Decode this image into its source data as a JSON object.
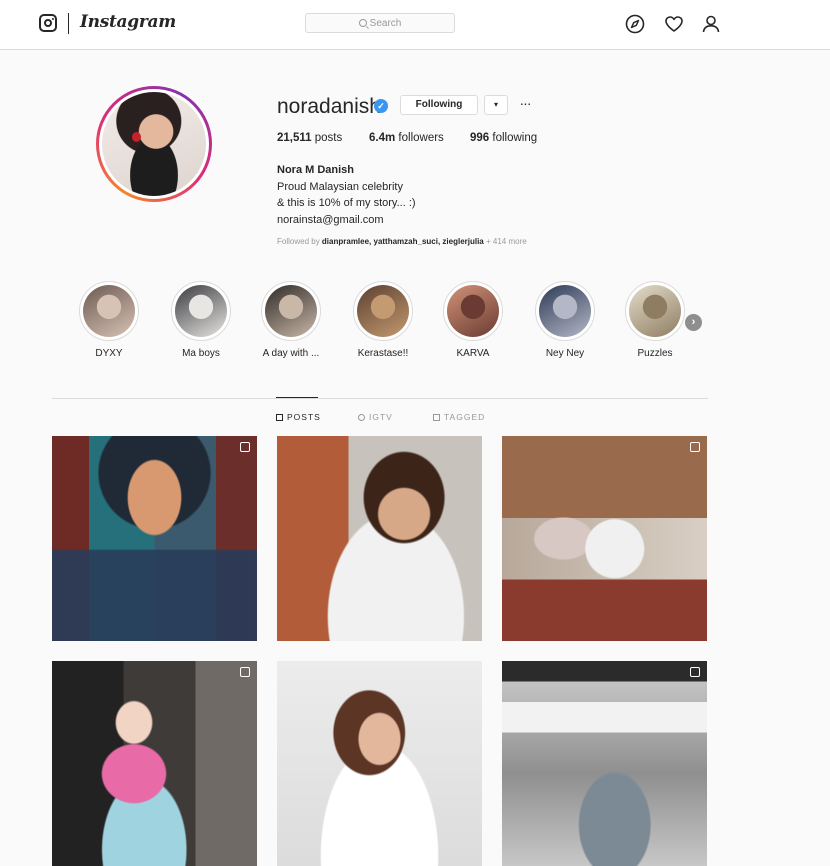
{
  "nav": {
    "logo_text": "Instagram",
    "search_placeholder": "Search",
    "icons": [
      "explore-compass-icon",
      "heart-icon",
      "profile-icon"
    ]
  },
  "profile": {
    "username": "noradanish",
    "verified": true,
    "following_button": "Following",
    "dropdown_glyph": "▾",
    "more_glyph": "···",
    "stats": {
      "posts_count": "21,511",
      "posts_label": "posts",
      "followers_count": "6.4m",
      "followers_label": "followers",
      "following_count": "996",
      "following_label": "following"
    },
    "full_name": "Nora M Danish",
    "bio_line1": "Proud Malaysian celebrity",
    "bio_line2": "& this is 10% of my story... :)",
    "email": "norainsta@gmail.com",
    "followed_by_prefix": "Followed by",
    "followed_by_names": "dianpramlee, yatthamzah_suci, zieglerjulia",
    "followed_by_more": "+ 414 more"
  },
  "highlights": [
    {
      "label": "DYXY",
      "colors": [
        "#d8c2b5",
        "#6c5a52"
      ]
    },
    {
      "label": "Ma boys",
      "colors": [
        "#e8e6e3",
        "#3b3b40"
      ]
    },
    {
      "label": "A day with ...",
      "colors": [
        "#c9b8a8",
        "#2f2a27"
      ]
    },
    {
      "label": "Kerastase!!",
      "colors": [
        "#c49a70",
        "#5b4030"
      ]
    },
    {
      "label": "KARVA",
      "colors": [
        "#6a3b32",
        "#d19378"
      ]
    },
    {
      "label": "Ney Ney",
      "colors": [
        "#b4b8c6",
        "#2d3a56"
      ]
    },
    {
      "label": "Puzzles",
      "colors": [
        "#8f7d62",
        "#e4dccb"
      ]
    }
  ],
  "tabs": [
    {
      "label": "POSTS",
      "active": true
    },
    {
      "label": "IGTV",
      "active": false
    },
    {
      "label": "TAGGED",
      "active": false
    }
  ],
  "posts": [
    {
      "multi": true
    },
    {
      "multi": false
    },
    {
      "multi": true
    },
    {
      "multi": true
    },
    {
      "multi": false
    },
    {
      "multi": true
    }
  ],
  "colors": {
    "accent_blue": "#3897f0",
    "border": "#dbdbdb",
    "text": "#262626",
    "muted": "#999999"
  }
}
